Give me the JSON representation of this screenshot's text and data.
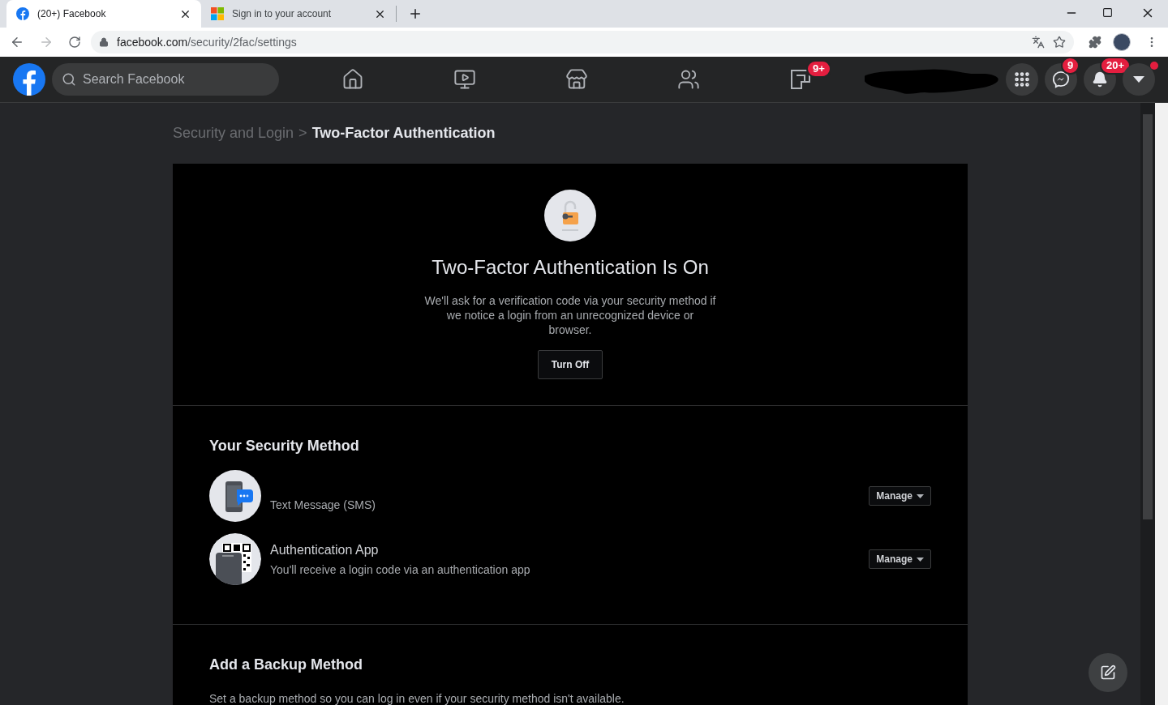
{
  "browser": {
    "tabs": [
      {
        "title": "(20+) Facebook",
        "selected": true
      },
      {
        "title": "Sign in to your account",
        "selected": false
      }
    ],
    "url_host": "facebook.com",
    "url_path": "/security/2fac/settings"
  },
  "header": {
    "search": {
      "placeholder": "Search Facebook"
    },
    "nav": [
      {
        "kind": "home"
      },
      {
        "kind": "watch"
      },
      {
        "kind": "marketplace"
      },
      {
        "kind": "groups"
      },
      {
        "kind": "gaming",
        "badge": "9+"
      }
    ],
    "actions": [
      {
        "kind": "menu",
        "dot": false
      },
      {
        "kind": "messenger",
        "badge": "9",
        "dot": false
      },
      {
        "kind": "notifications",
        "badge": "20+",
        "dot": false
      },
      {
        "kind": "account",
        "dot": true
      }
    ]
  },
  "breadcrumb": {
    "parent": "Security and Login",
    "separator": ">",
    "current": "Two-Factor Authentication"
  },
  "status": {
    "title": "Two-Factor Authentication Is On",
    "description": "We'll ask for a verification code via your security method if we notice a login from an unrecognized device or browser.",
    "button": "Turn Off"
  },
  "security_method": {
    "heading": "Your Security Method",
    "methods": [
      {
        "kind": "sms",
        "subtitle": "Text Message (SMS)",
        "button": "Manage"
      },
      {
        "kind": "app",
        "title": "Authentication App",
        "subtitle": "You'll receive a login code via an authentication app",
        "button": "Manage"
      }
    ]
  },
  "backup": {
    "heading": "Add a Backup Method",
    "description": "Set a backup method so you can log in even if your security method isn't available."
  }
}
